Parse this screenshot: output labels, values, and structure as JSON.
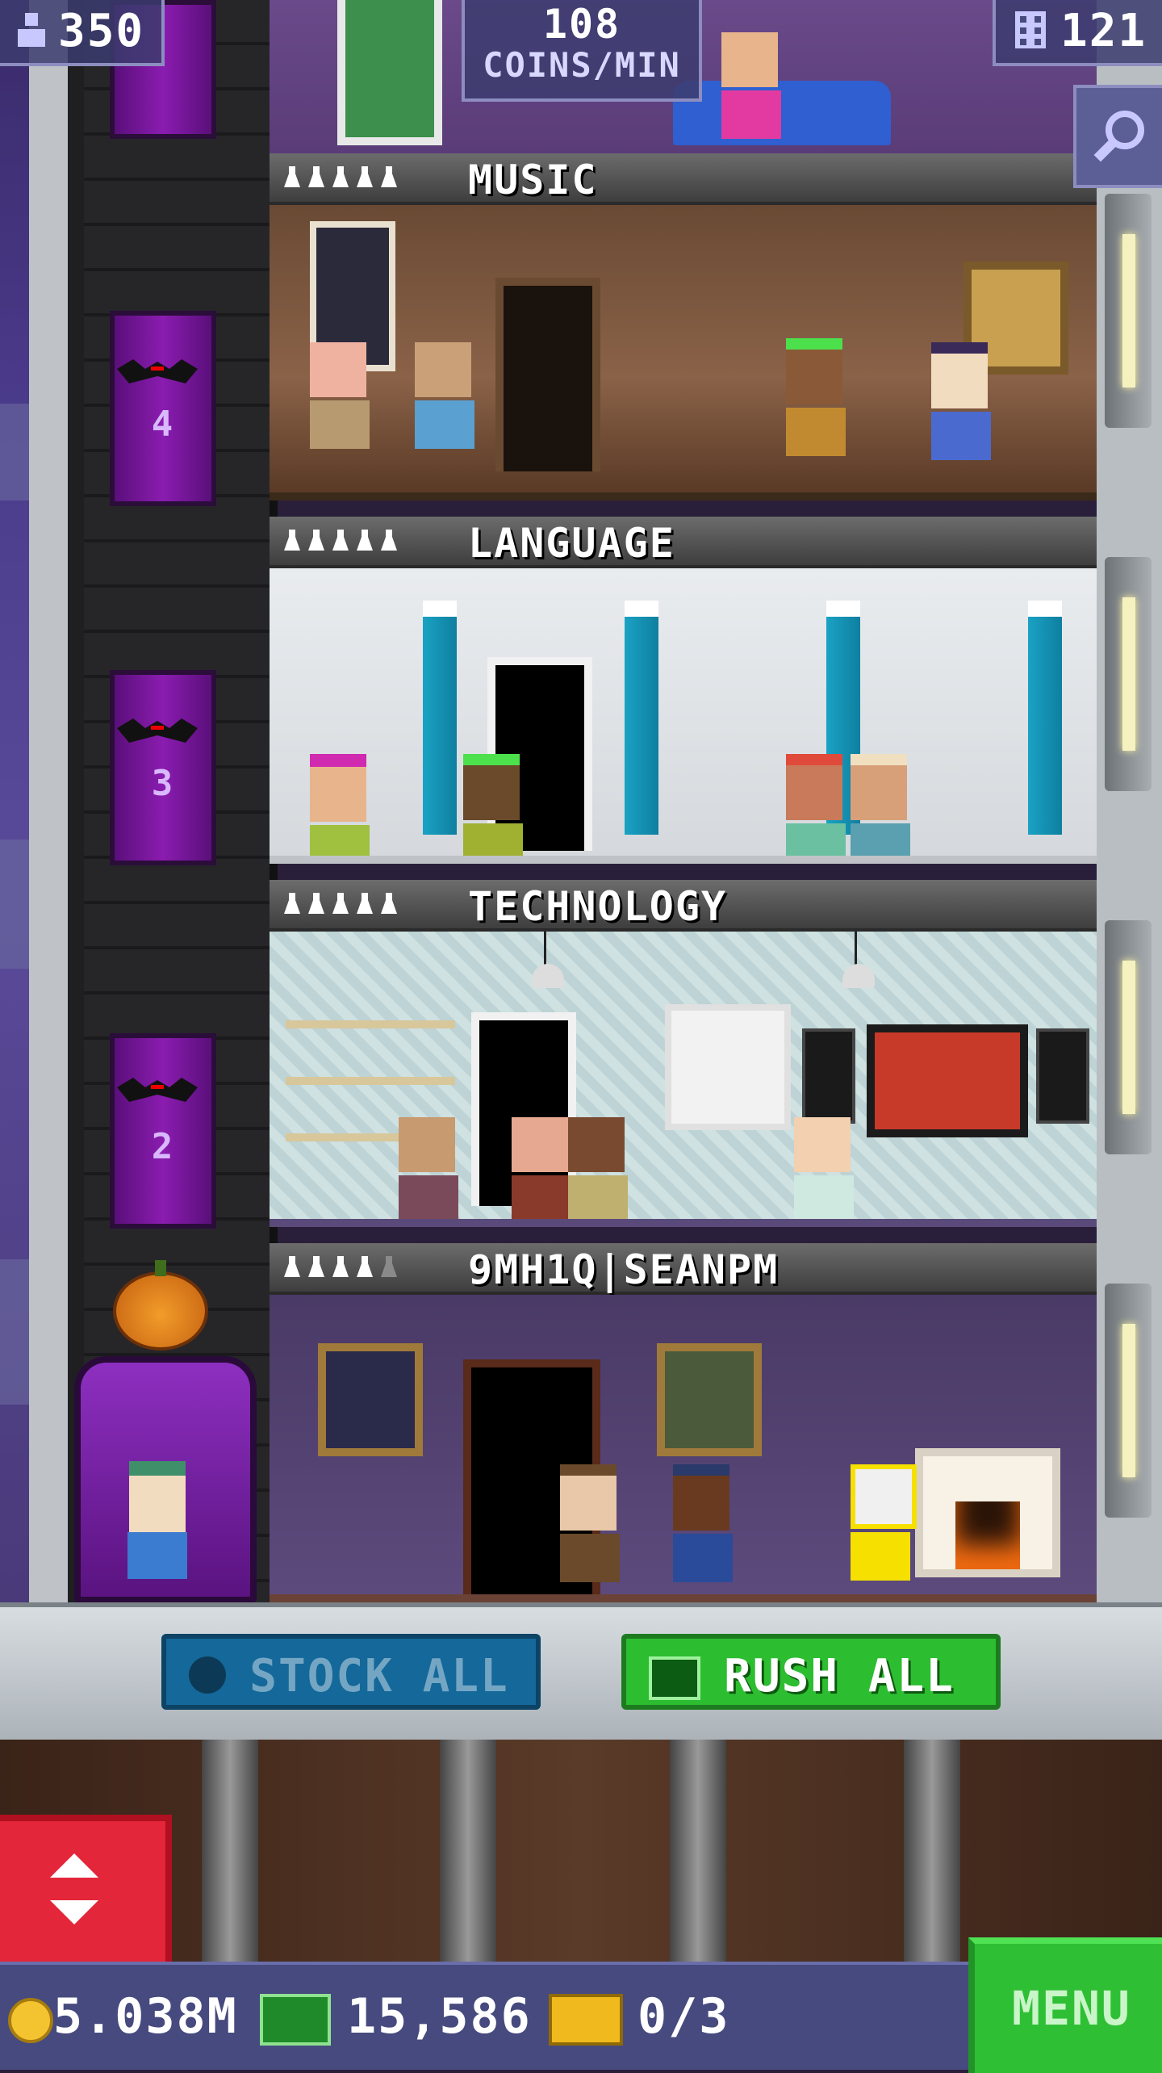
{
  "hud": {
    "population": "350",
    "coins_per_min_value": "108",
    "coins_per_min_label": "COINS/MIN",
    "floor_count": "121"
  },
  "floors": [
    {
      "name": "MUSIC",
      "stars": 5
    },
    {
      "name": "LANGUAGE",
      "stars": 5
    },
    {
      "name": "TECHNOLOGY",
      "stars": 5
    },
    {
      "name": "9MH1Q|SEANPM",
      "stars": 4
    }
  ],
  "elevator": {
    "floor_numbers": [
      "4",
      "3",
      "2"
    ]
  },
  "actions": {
    "stock_all": "STOCK ALL",
    "rush_all": "RUSH ALL"
  },
  "status": {
    "coins": "5.038M",
    "bux": "15,586",
    "vip": "0/3",
    "menu": "MENU"
  },
  "icons": {
    "population": "person-icon",
    "floors": "building-icon",
    "search": "magnifier-icon",
    "stock": "clock-icon",
    "rush": "bux-icon",
    "elevator": "up-down-arrows-icon",
    "coin": "coin-icon",
    "vip": "vip-ticket-icon"
  },
  "colors": {
    "rush_green": "#2dbd31",
    "stock_blue": "#14689a",
    "elevator_purple": "#8a1cb0",
    "elevator_red_button": "#e3263a"
  }
}
